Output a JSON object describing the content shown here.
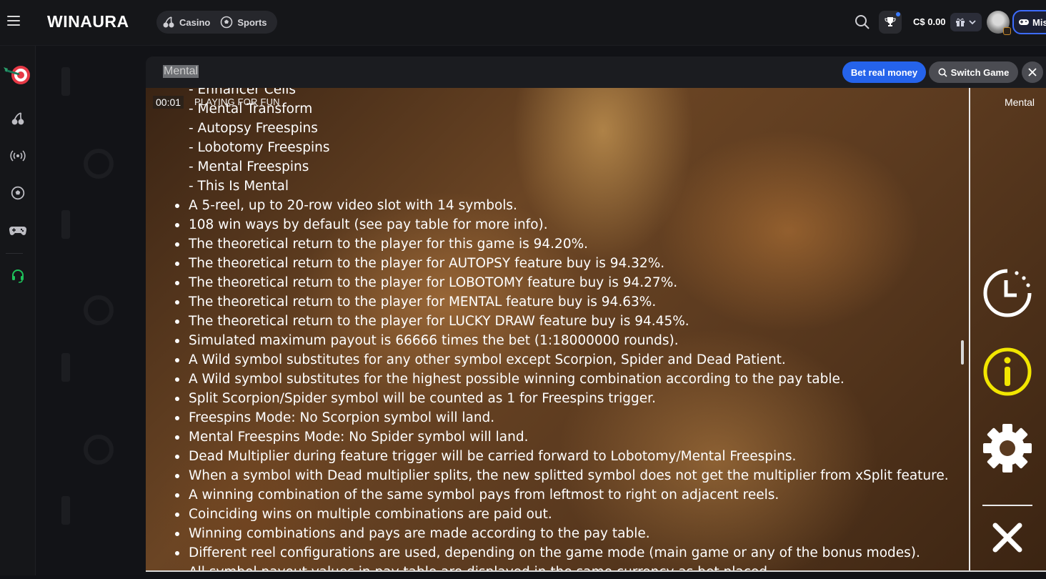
{
  "header": {
    "logo": "WINAURA",
    "nav": [
      {
        "label": "Casino",
        "icon": "cherries-icon"
      },
      {
        "label": "Sports",
        "icon": "soccer-ball-icon"
      }
    ],
    "balance": "C$ 0.00",
    "missions_label": "Mis"
  },
  "sidebar": {
    "items": [
      {
        "icon": "darts-target-icon"
      },
      {
        "icon": "cherries-icon"
      },
      {
        "icon": "live-broadcast-icon"
      },
      {
        "icon": "soccer-ball-icon"
      },
      {
        "icon": "gamepad-icon"
      },
      {
        "icon": "headset-support-icon"
      }
    ]
  },
  "game_bar": {
    "title": "Mental",
    "bet_real_label": "Bet real money",
    "switch_game_label": "Switch Game"
  },
  "game": {
    "timer": "00:01",
    "mode": "PLAYING FOR FUN",
    "name_right": "Mental",
    "sub_items": [
      "- Enhancer Cells",
      "- Mental Transform",
      "- Autopsy Freespins",
      "- Lobotomy Freespins",
      "- Mental Freespins",
      "- This Is Mental"
    ],
    "rules": [
      "A 5-reel, up to 20-row video slot with 14 symbols.",
      "108 win ways by default (see pay table for more info).",
      "The theoretical return to the player for this game is 94.20%.",
      "The theoretical return to the player for AUTOPSY feature buy is 94.32%.",
      "The theoretical return to the player for LOBOTOMY feature buy is 94.27%.",
      "The theoretical return to the player for MENTAL feature buy is 94.63%.",
      "The theoretical return to the player for LUCKY DRAW feature buy is 94.45%.",
      "Simulated maximum payout is 66666 times the bet (1:18000000 rounds).",
      "A Wild symbol substitutes for any other symbol except Scorpion, Spider and Dead Patient.",
      "A Wild symbol substitutes for the highest possible winning combination according to the pay table.",
      "Split Scorpion/Spider symbol will be counted as 1 for Freespins trigger.",
      "Freespins Mode: No Scorpion symbol will land.",
      "Mental Freespins Mode: No Spider symbol will land.",
      "Dead Multiplier during feature trigger will be carried forward to Lobotomy/Mental Freespins.",
      "When a symbol with Dead multiplier splits, the new splitted symbol does not get the multiplier from xSplit feature.",
      "A winning combination of the same symbol pays from leftmost to right on adjacent reels.",
      "Coinciding wins on multiple combinations are paid out.",
      "Winning combinations and pays are made according to the pay table.",
      "Different reel configurations are used, depending on the game mode (main game or any of the bonus modes).",
      "All symbol payout values in pay table are displayed in the same currency as bet placed."
    ],
    "side_controls": [
      {
        "icon": "history-clock-icon"
      },
      {
        "icon": "info-icon",
        "color": "#f2e600"
      },
      {
        "icon": "settings-gear-icon"
      },
      {
        "icon": "close-x-icon"
      }
    ]
  },
  "colors": {
    "accent_blue": "#2563eb",
    "info_yellow": "#f2e600",
    "support_green": "#1ec15a"
  }
}
